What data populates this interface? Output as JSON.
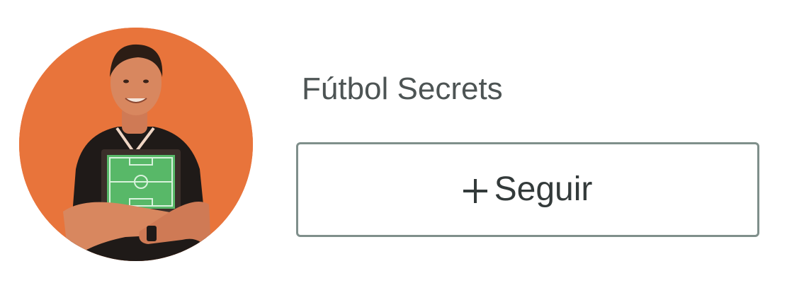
{
  "author": {
    "name": "Fútbol Secrets",
    "avatar_icon": "person-holding-tactics-board",
    "avatar_background": "#e8743b"
  },
  "follow": {
    "icon": "plus-icon",
    "label": "Seguir",
    "border_color": "#7f8f8b",
    "text_color": "#333a3a"
  }
}
